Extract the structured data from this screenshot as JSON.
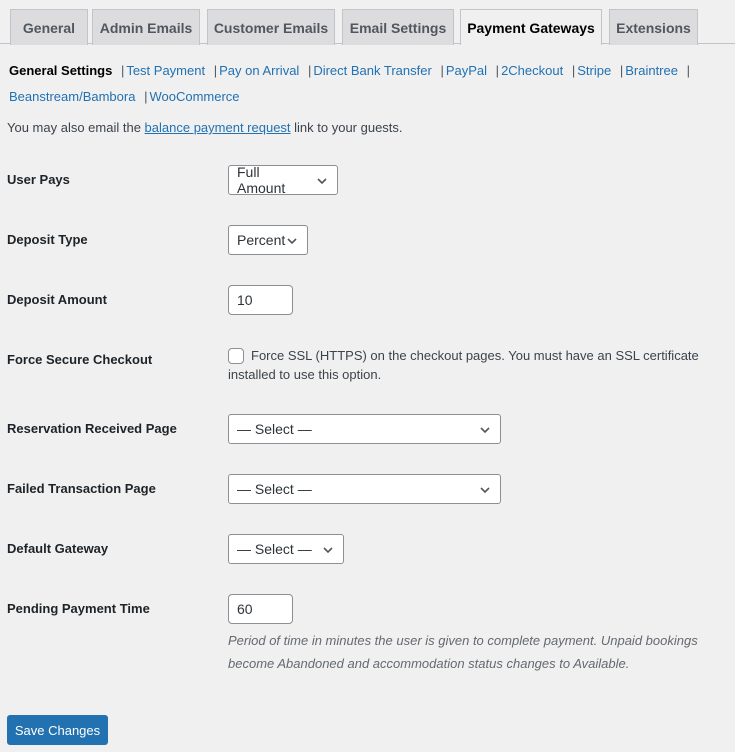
{
  "tabs": [
    {
      "label": "General",
      "active": false
    },
    {
      "label": "Admin Emails",
      "active": false
    },
    {
      "label": "Customer Emails",
      "active": false
    },
    {
      "label": "Email Settings",
      "active": false
    },
    {
      "label": "Payment Gateways",
      "active": true
    },
    {
      "label": "Extensions",
      "active": false
    }
  ],
  "subnav": {
    "current": "General Settings",
    "separator": "|",
    "links": [
      "Test Payment",
      "Pay on Arrival",
      "Direct Bank Transfer",
      "PayPal",
      "2Checkout",
      "Stripe",
      "Braintree",
      "Beanstream/Bambora",
      "WooCommerce"
    ]
  },
  "intro": {
    "before": "You may also email the ",
    "link": "balance payment request",
    "after": " link to your guests."
  },
  "fields": {
    "user_pays": {
      "label": "User Pays",
      "value": "Full Amount"
    },
    "deposit_type": {
      "label": "Deposit Type",
      "value": "Percent"
    },
    "deposit_amount": {
      "label": "Deposit Amount",
      "value": "10"
    },
    "force_secure": {
      "label": "Force Secure Checkout",
      "checked": false,
      "text": "Force SSL (HTTPS) on the checkout pages. You must have an SSL certificate installed to use this option."
    },
    "reservation_received_page": {
      "label": "Reservation Received Page",
      "value": "— Select —"
    },
    "failed_transaction_page": {
      "label": "Failed Transaction Page",
      "value": "— Select —"
    },
    "default_gateway": {
      "label": "Default Gateway",
      "value": "— Select —"
    },
    "pending_payment_time": {
      "label": "Pending Payment Time",
      "value": "60",
      "description": "Period of time in minutes the user is given to complete payment. Unpaid bookings become Abandoned and accommodation status changes to Available."
    }
  },
  "save_label": "Save Changes"
}
